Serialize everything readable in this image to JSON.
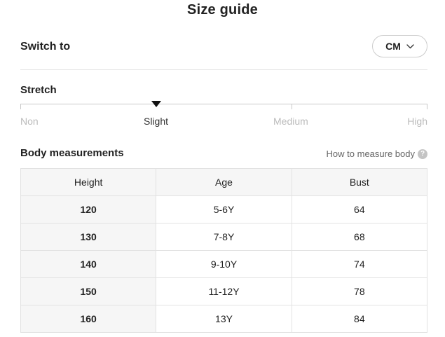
{
  "header": {
    "title": "Size guide"
  },
  "switch": {
    "label": "Switch to",
    "unit": "CM",
    "dropdown_icon": "chevron-down-icon"
  },
  "stretch": {
    "title": "Stretch",
    "levels": [
      "Non",
      "Slight",
      "Medium",
      "High"
    ],
    "selected": "Slight"
  },
  "measurements": {
    "title": "Body measurements",
    "how_to_label": "How to measure body",
    "help_icon": "question-icon",
    "help_glyph": "?",
    "columns": [
      "Height",
      "Age",
      "Bust"
    ],
    "rows": [
      [
        "120",
        "5-6Y",
        "64"
      ],
      [
        "130",
        "7-8Y",
        "68"
      ],
      [
        "140",
        "9-10Y",
        "74"
      ],
      [
        "150",
        "11-12Y",
        "78"
      ],
      [
        "160",
        "13Y",
        "84"
      ]
    ]
  },
  "colors": {
    "text": "#222222",
    "muted": "#bbbbbb",
    "header_bg": "#f6f6f6",
    "border": "#e2e2e2"
  }
}
